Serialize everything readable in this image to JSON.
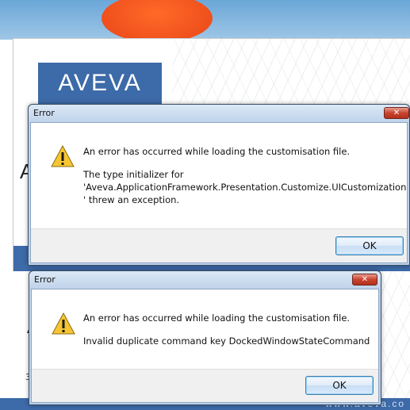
{
  "splash": {
    "logo_text": "AVEVA",
    "partial_letter": "A",
    "lower_partial_letter": "A",
    "lower_small_text": "3",
    "footer_text": "www.aveva.co"
  },
  "dialogs": [
    {
      "title": "Error",
      "close_symbol": "✕",
      "icon": "warning-icon",
      "message_line1": "An error has occurred while loading the customisation file.",
      "message_line2": "The type initializer for\n'Aveva.ApplicationFramework.Presentation.Customize.UICustomization\n' threw an exception.",
      "ok_label": "OK"
    },
    {
      "title": "Error",
      "close_symbol": "✕",
      "icon": "warning-icon",
      "message_line1": "An error has occurred while loading the customisation file.",
      "message_line2": "Invalid duplicate command key DockedWindowStateCommand",
      "ok_label": "OK"
    }
  ],
  "colors": {
    "brand_blue": "#3d6aa8",
    "warning_yellow": "#f6c531",
    "close_red": "#c8442f"
  }
}
